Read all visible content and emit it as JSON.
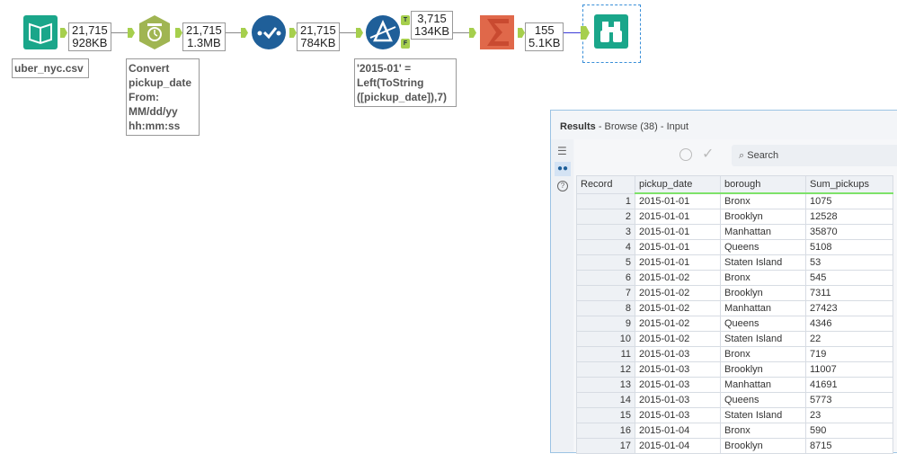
{
  "workflow": {
    "input_label": "uber_nyc.csv",
    "badges": [
      {
        "rows": "21,715",
        "size": "928KB"
      },
      {
        "rows": "21,715",
        "size": "1.3MB"
      },
      {
        "rows": "21,715",
        "size": "784KB"
      },
      {
        "rows": "3,715",
        "size": "134KB"
      },
      {
        "rows": "155",
        "size": "5.1KB"
      }
    ],
    "datetime_note": [
      "Convert",
      "pickup_date",
      "From:",
      "MM/dd/yy",
      "hh:mm:ss"
    ],
    "filter_note": [
      "'2015-01' =",
      "Left(ToString",
      "([pickup_date]),7)"
    ],
    "filter_true": "T",
    "filter_false": "F"
  },
  "results": {
    "title": "Results",
    "subtitle": "- Browse (38) - Input",
    "search_placeholder": "Search",
    "columns": [
      "Record",
      "pickup_date",
      "borough",
      "Sum_pickups"
    ],
    "rows": [
      [
        "1",
        "2015-01-01",
        "Bronx",
        "1075"
      ],
      [
        "2",
        "2015-01-01",
        "Brooklyn",
        "12528"
      ],
      [
        "3",
        "2015-01-01",
        "Manhattan",
        "35870"
      ],
      [
        "4",
        "2015-01-01",
        "Queens",
        "5108"
      ],
      [
        "5",
        "2015-01-01",
        "Staten Island",
        "53"
      ],
      [
        "6",
        "2015-01-02",
        "Bronx",
        "545"
      ],
      [
        "7",
        "2015-01-02",
        "Brooklyn",
        "7311"
      ],
      [
        "8",
        "2015-01-02",
        "Manhattan",
        "27423"
      ],
      [
        "9",
        "2015-01-02",
        "Queens",
        "4346"
      ],
      [
        "10",
        "2015-01-02",
        "Staten Island",
        "22"
      ],
      [
        "11",
        "2015-01-03",
        "Bronx",
        "719"
      ],
      [
        "12",
        "2015-01-03",
        "Brooklyn",
        "11007"
      ],
      [
        "13",
        "2015-01-03",
        "Manhattan",
        "41691"
      ],
      [
        "14",
        "2015-01-03",
        "Queens",
        "5773"
      ],
      [
        "15",
        "2015-01-03",
        "Staten Island",
        "23"
      ],
      [
        "16",
        "2015-01-04",
        "Bronx",
        "590"
      ],
      [
        "17",
        "2015-01-04",
        "Brooklyn",
        "8715"
      ]
    ]
  }
}
